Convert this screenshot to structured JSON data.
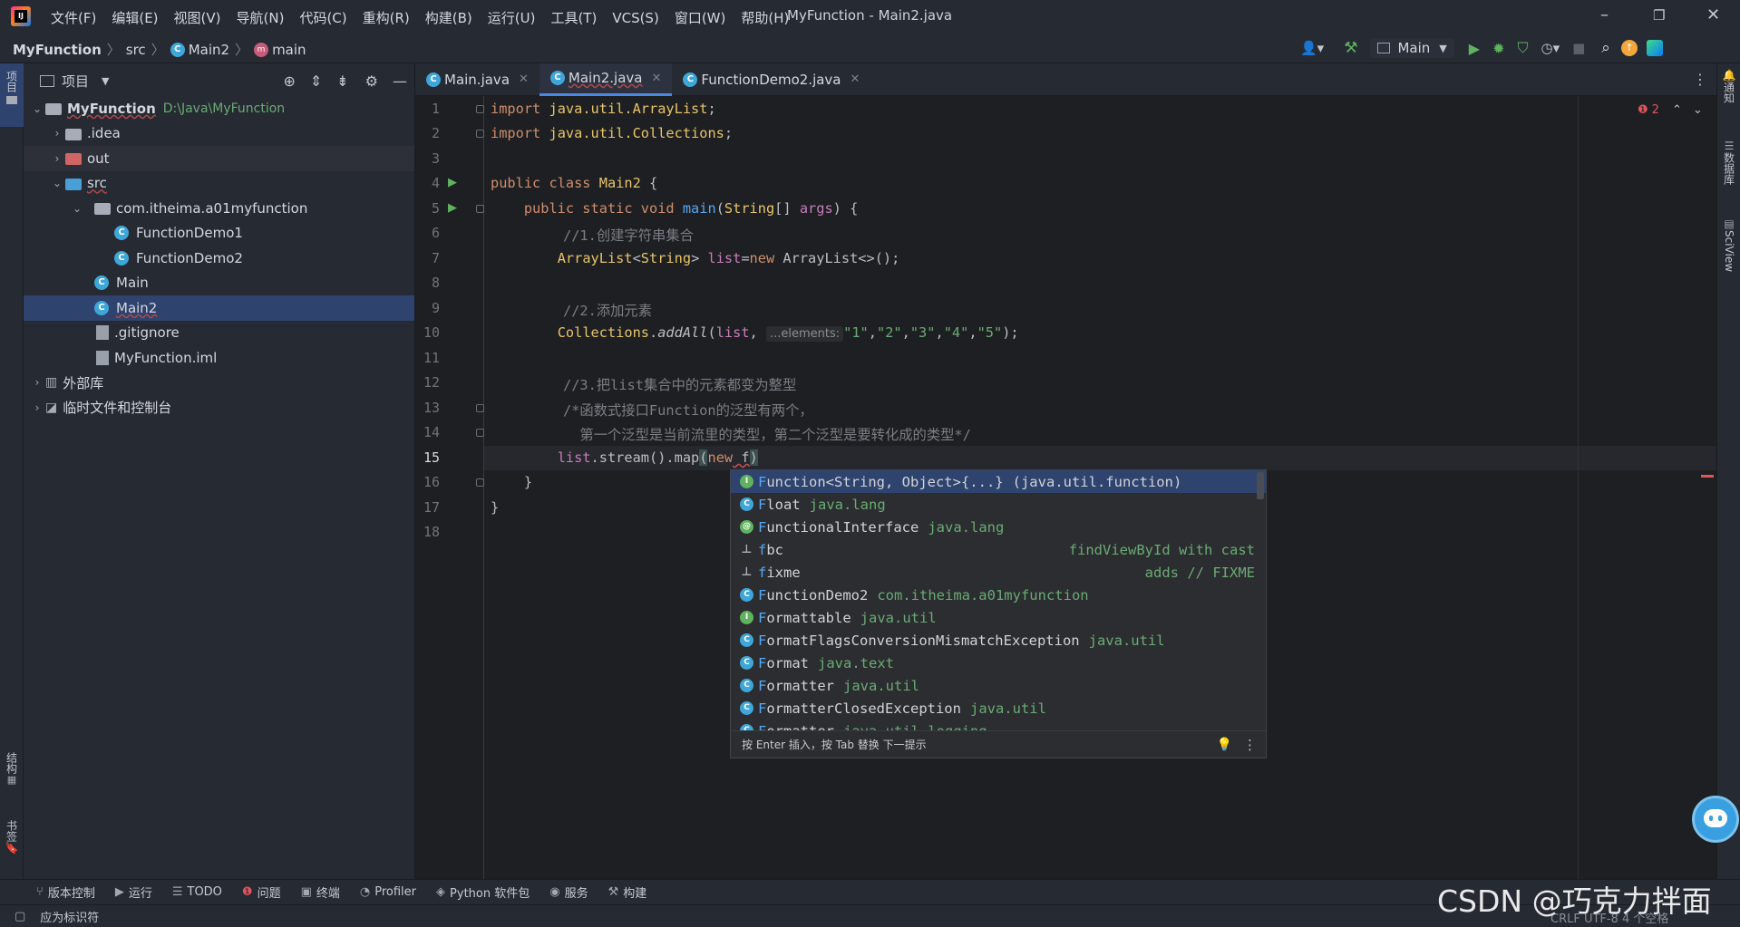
{
  "titlebar": {
    "menu": [
      "文件(F)",
      "编辑(E)",
      "视图(V)",
      "导航(N)",
      "代码(C)",
      "重构(R)",
      "构建(B)",
      "运行(U)",
      "工具(T)",
      "VCS(S)",
      "窗口(W)",
      "帮助(H)"
    ],
    "window_title": "MyFunction - Main2.java"
  },
  "navbar": {
    "crumbs": [
      "MyFunction",
      "src",
      "Main2",
      "main"
    ],
    "run_config": "Main"
  },
  "left_strip": {
    "top_label": "项目",
    "bottom_labels": [
      "结构",
      "书签"
    ]
  },
  "right_strip": {
    "labels": [
      "通知",
      "数据库",
      "SciView"
    ]
  },
  "project": {
    "title": "项目",
    "root_name": "MyFunction",
    "root_path": "D:\\Java\\MyFunction",
    "items": {
      "idea": ".idea",
      "out": "out",
      "src": "src",
      "pkg": "com.itheima.a01myfunction",
      "fd1": "FunctionDemo1",
      "fd2": "FunctionDemo2",
      "main": "Main",
      "main2": "Main2",
      "gitignore": ".gitignore",
      "iml": "MyFunction.iml",
      "extlib": "外部库",
      "scratch": "临时文件和控制台"
    }
  },
  "tabs": [
    "Main.java",
    "Main2.java",
    "FunctionDemo2.java"
  ],
  "editor": {
    "error_count": "2",
    "line_numbers": [
      "1",
      "2",
      "3",
      "4",
      "5",
      "6",
      "7",
      "8",
      "9",
      "10",
      "11",
      "12",
      "13",
      "14",
      "15",
      "16",
      "17",
      "18"
    ],
    "comment1": "//1.创建字符串集合",
    "comment2": "//2.添加元素",
    "comment3": "//3.把list集合中的元素都变为整型",
    "comment4": "/*函数式接口Function的泛型有两个，",
    "comment5": "  第一个泛型是当前流里的类型，第二个泛型是要转化成的类型*/",
    "param_hint": "...elements:"
  },
  "completion": {
    "items": [
      {
        "icon": "I",
        "kind": "i",
        "prefix": "F",
        "name": "unction<String, Object>{...}",
        "pkg": "(java.util.function)",
        "right": ""
      },
      {
        "icon": "C",
        "kind": "c",
        "prefix": "F",
        "name": "loat",
        "pkg": "java.lang",
        "right": ""
      },
      {
        "icon": "@",
        "kind": "a",
        "prefix": "F",
        "name": "unctionalInterface",
        "pkg": "java.lang",
        "right": ""
      },
      {
        "icon": "⊥",
        "kind": "t",
        "prefix": "f",
        "name": "bc",
        "pkg": "",
        "right": "findViewById with cast"
      },
      {
        "icon": "⊥",
        "kind": "t",
        "prefix": "f",
        "name": "ixme",
        "pkg": "",
        "right": "adds // FIXME"
      },
      {
        "icon": "C",
        "kind": "c",
        "prefix": "F",
        "name": "unctionDemo2",
        "pkg": "com.itheima.a01myfunction",
        "right": ""
      },
      {
        "icon": "I",
        "kind": "i",
        "prefix": "F",
        "name": "ormattable",
        "pkg": "java.util",
        "right": ""
      },
      {
        "icon": "C",
        "kind": "c",
        "prefix": "F",
        "name": "ormatFlagsConversionMismatchException",
        "pkg": "java.util",
        "right": ""
      },
      {
        "icon": "C",
        "kind": "c",
        "prefix": "F",
        "name": "ormat",
        "pkg": "java.text",
        "right": ""
      },
      {
        "icon": "C",
        "kind": "c",
        "prefix": "F",
        "name": "ormatter",
        "pkg": "java.util",
        "right": ""
      },
      {
        "icon": "C",
        "kind": "c",
        "prefix": "F",
        "name": "ormatterClosedException",
        "pkg": "java.util",
        "right": ""
      },
      {
        "icon": "C",
        "kind": "c",
        "prefix": "F",
        "name": "ormatter",
        "pkg": "java.util.logging",
        "right": ""
      }
    ],
    "footer": "按 Enter 插入，按 Tab 替换  下一提示"
  },
  "bottom_tools": [
    "版本控制",
    "运行",
    "TODO",
    "问题",
    "终端",
    "Profiler",
    "Python 软件包",
    "服务",
    "构建"
  ],
  "status": {
    "message": "应为标识符",
    "right": "CRLF  UTF-8  4 个空格"
  },
  "watermark": "CSDN @巧克力拌面",
  "colors": {
    "accent": "#4a88e6",
    "selection": "#2e436e",
    "keyword": "#cf8e6d",
    "class": "#e8c46a",
    "string": "#6aab73"
  }
}
